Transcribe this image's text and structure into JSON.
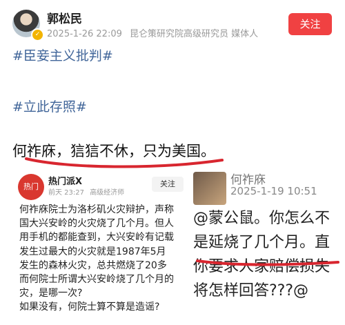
{
  "header": {
    "author": "郭松民",
    "meta": [
      "2025-1-26 22:09",
      "昆仑策研究院高级研究员 媒体人"
    ],
    "follow_label": "关注",
    "badge": "✓"
  },
  "post": {
    "tags": [
      "#臣妾主义批判#",
      "#立此存照#"
    ],
    "main_text": "何祚庥，狺狺不休，只为美国。"
  },
  "left_card": {
    "avatar_text": "热门",
    "name": "热门派X",
    "meta": [
      "前天 23:27",
      "高级经济师"
    ],
    "follow_label": "关注",
    "lines": [
      "何祚庥院士为洛杉矶火灾辩护，声称",
      "国大兴安岭的火灾烧了几个月。但人",
      "用手机的都能查到，大兴安岭有记载",
      "发生过最大的火灾就是1987年5月",
      "发生的森林火灾，总共燃烧了20多",
      "而何院士所谓大兴安岭烧了几个月的",
      "灾，是哪一次?",
      "如果没有，何院士算不算是造谣?"
    ]
  },
  "right_card": {
    "name": "何祚庥",
    "time": "2025-1-19 10:51",
    "lines": [
      "@蒙公鼠。你怎么不",
      "是延烧了几个月。直",
      "你要求人家赔偿损失",
      "将怎样回答???@"
    ]
  },
  "colors": {
    "accent": "#f04142",
    "tag": "#406599",
    "underline": "#d8262f"
  }
}
